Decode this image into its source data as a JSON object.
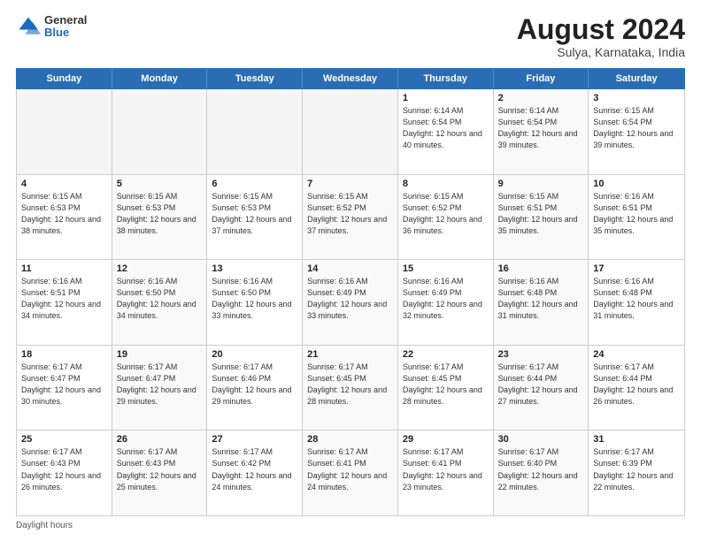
{
  "logo": {
    "general": "General",
    "blue": "Blue"
  },
  "title": "August 2024",
  "location": "Sulya, Karnataka, India",
  "days_of_week": [
    "Sunday",
    "Monday",
    "Tuesday",
    "Wednesday",
    "Thursday",
    "Friday",
    "Saturday"
  ],
  "footer": "Daylight hours",
  "weeks": [
    [
      {
        "day": "",
        "info": ""
      },
      {
        "day": "",
        "info": ""
      },
      {
        "day": "",
        "info": ""
      },
      {
        "day": "",
        "info": ""
      },
      {
        "day": "1",
        "info": "Sunrise: 6:14 AM\nSunset: 6:54 PM\nDaylight: 12 hours\nand 40 minutes."
      },
      {
        "day": "2",
        "info": "Sunrise: 6:14 AM\nSunset: 6:54 PM\nDaylight: 12 hours\nand 39 minutes."
      },
      {
        "day": "3",
        "info": "Sunrise: 6:15 AM\nSunset: 6:54 PM\nDaylight: 12 hours\nand 39 minutes."
      }
    ],
    [
      {
        "day": "4",
        "info": "Sunrise: 6:15 AM\nSunset: 6:53 PM\nDaylight: 12 hours\nand 38 minutes."
      },
      {
        "day": "5",
        "info": "Sunrise: 6:15 AM\nSunset: 6:53 PM\nDaylight: 12 hours\nand 38 minutes."
      },
      {
        "day": "6",
        "info": "Sunrise: 6:15 AM\nSunset: 6:53 PM\nDaylight: 12 hours\nand 37 minutes."
      },
      {
        "day": "7",
        "info": "Sunrise: 6:15 AM\nSunset: 6:52 PM\nDaylight: 12 hours\nand 37 minutes."
      },
      {
        "day": "8",
        "info": "Sunrise: 6:15 AM\nSunset: 6:52 PM\nDaylight: 12 hours\nand 36 minutes."
      },
      {
        "day": "9",
        "info": "Sunrise: 6:15 AM\nSunset: 6:51 PM\nDaylight: 12 hours\nand 35 minutes."
      },
      {
        "day": "10",
        "info": "Sunrise: 6:16 AM\nSunset: 6:51 PM\nDaylight: 12 hours\nand 35 minutes."
      }
    ],
    [
      {
        "day": "11",
        "info": "Sunrise: 6:16 AM\nSunset: 6:51 PM\nDaylight: 12 hours\nand 34 minutes."
      },
      {
        "day": "12",
        "info": "Sunrise: 6:16 AM\nSunset: 6:50 PM\nDaylight: 12 hours\nand 34 minutes."
      },
      {
        "day": "13",
        "info": "Sunrise: 6:16 AM\nSunset: 6:50 PM\nDaylight: 12 hours\nand 33 minutes."
      },
      {
        "day": "14",
        "info": "Sunrise: 6:16 AM\nSunset: 6:49 PM\nDaylight: 12 hours\nand 33 minutes."
      },
      {
        "day": "15",
        "info": "Sunrise: 6:16 AM\nSunset: 6:49 PM\nDaylight: 12 hours\nand 32 minutes."
      },
      {
        "day": "16",
        "info": "Sunrise: 6:16 AM\nSunset: 6:48 PM\nDaylight: 12 hours\nand 31 minutes."
      },
      {
        "day": "17",
        "info": "Sunrise: 6:16 AM\nSunset: 6:48 PM\nDaylight: 12 hours\nand 31 minutes."
      }
    ],
    [
      {
        "day": "18",
        "info": "Sunrise: 6:17 AM\nSunset: 6:47 PM\nDaylight: 12 hours\nand 30 minutes."
      },
      {
        "day": "19",
        "info": "Sunrise: 6:17 AM\nSunset: 6:47 PM\nDaylight: 12 hours\nand 29 minutes."
      },
      {
        "day": "20",
        "info": "Sunrise: 6:17 AM\nSunset: 6:46 PM\nDaylight: 12 hours\nand 29 minutes."
      },
      {
        "day": "21",
        "info": "Sunrise: 6:17 AM\nSunset: 6:45 PM\nDaylight: 12 hours\nand 28 minutes."
      },
      {
        "day": "22",
        "info": "Sunrise: 6:17 AM\nSunset: 6:45 PM\nDaylight: 12 hours\nand 28 minutes."
      },
      {
        "day": "23",
        "info": "Sunrise: 6:17 AM\nSunset: 6:44 PM\nDaylight: 12 hours\nand 27 minutes."
      },
      {
        "day": "24",
        "info": "Sunrise: 6:17 AM\nSunset: 6:44 PM\nDaylight: 12 hours\nand 26 minutes."
      }
    ],
    [
      {
        "day": "25",
        "info": "Sunrise: 6:17 AM\nSunset: 6:43 PM\nDaylight: 12 hours\nand 26 minutes."
      },
      {
        "day": "26",
        "info": "Sunrise: 6:17 AM\nSunset: 6:43 PM\nDaylight: 12 hours\nand 25 minutes."
      },
      {
        "day": "27",
        "info": "Sunrise: 6:17 AM\nSunset: 6:42 PM\nDaylight: 12 hours\nand 24 minutes."
      },
      {
        "day": "28",
        "info": "Sunrise: 6:17 AM\nSunset: 6:41 PM\nDaylight: 12 hours\nand 24 minutes."
      },
      {
        "day": "29",
        "info": "Sunrise: 6:17 AM\nSunset: 6:41 PM\nDaylight: 12 hours\nand 23 minutes."
      },
      {
        "day": "30",
        "info": "Sunrise: 6:17 AM\nSunset: 6:40 PM\nDaylight: 12 hours\nand 22 minutes."
      },
      {
        "day": "31",
        "info": "Sunrise: 6:17 AM\nSunset: 6:39 PM\nDaylight: 12 hours\nand 22 minutes."
      }
    ]
  ]
}
